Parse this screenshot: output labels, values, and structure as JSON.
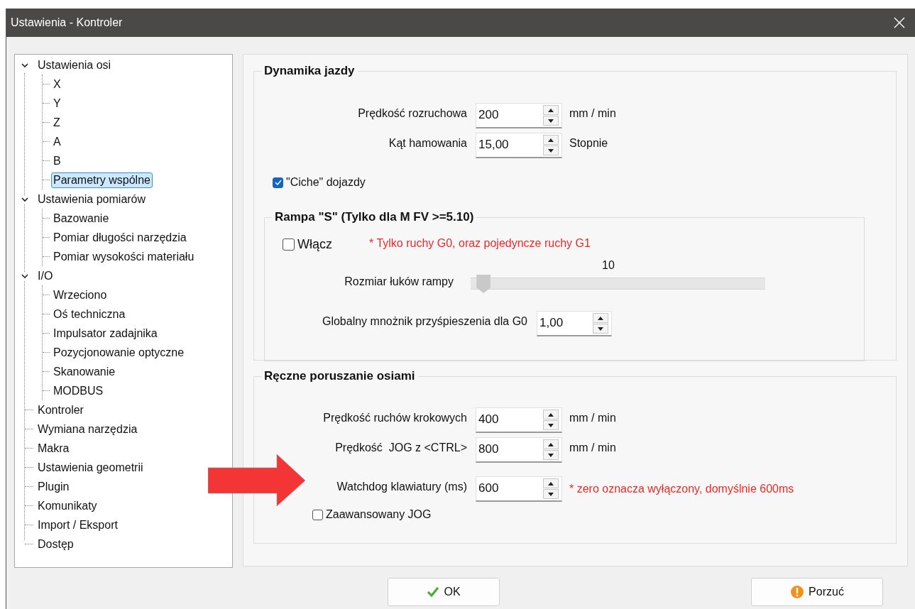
{
  "window": {
    "title": "Ustawienia - Kontroler"
  },
  "tree": [
    {
      "label": "Ustawienia osi",
      "expanded": true,
      "selected": false,
      "children": [
        {
          "label": "X",
          "selected": false
        },
        {
          "label": "Y",
          "selected": false
        },
        {
          "label": "Z",
          "selected": false
        },
        {
          "label": "A",
          "selected": false
        },
        {
          "label": "B",
          "selected": false
        },
        {
          "label": "Parametry wspólne",
          "selected": true
        }
      ]
    },
    {
      "label": "Ustawienia pomiarów",
      "expanded": true,
      "selected": false,
      "children": [
        {
          "label": "Bazowanie",
          "selected": false
        },
        {
          "label": "Pomiar długości narzędzia",
          "selected": false
        },
        {
          "label": "Pomiar wysokości materiału",
          "selected": false
        }
      ]
    },
    {
      "label": "I/O",
      "expanded": true,
      "selected": false,
      "children": [
        {
          "label": "Wrzeciono",
          "selected": false
        },
        {
          "label": "Oś techniczna",
          "selected": false
        },
        {
          "label": "Impulsator zadajnika",
          "selected": false
        },
        {
          "label": "Pozycjonowanie optyczne",
          "selected": false
        },
        {
          "label": "Skanowanie",
          "selected": false
        },
        {
          "label": "MODBUS",
          "selected": false
        }
      ]
    },
    {
      "label": "Kontroler",
      "selected": false
    },
    {
      "label": "Wymiana narzędzia",
      "selected": false
    },
    {
      "label": "Makra",
      "selected": false
    },
    {
      "label": "Ustawienia geometrii",
      "selected": false
    },
    {
      "label": "Plugin",
      "selected": false
    },
    {
      "label": "Komunikaty",
      "selected": false
    },
    {
      "label": "Import / Eksport",
      "selected": false
    },
    {
      "label": "Dostęp",
      "selected": false
    }
  ],
  "dynamics": {
    "title": "Dynamika jazdy",
    "fields": [
      {
        "label": "Prędkość rozruchowa",
        "value": "200",
        "unit": "mm / min"
      },
      {
        "label": "Kąt hamowania",
        "value": "15,00",
        "unit": "Stopnie"
      }
    ],
    "quiet_moves": {
      "label": "\"Ciche\" dojazdy",
      "checked": true
    }
  },
  "ramp": {
    "title": "Rampa \"S\" (Tylko dla M FV >=5.10)",
    "enable": {
      "label": "Włącz",
      "checked": false
    },
    "note": "* Tylko ruchy G0, oraz pojedyncze ruchy G1",
    "slider": {
      "label": "Rozmiar łuków rampy",
      "reading": "10",
      "level": 0.02
    },
    "multiplier": {
      "label": "Globalny mnożnik przyśpieszenia dla G0",
      "value": "1,00"
    }
  },
  "manual": {
    "title": "Ręczne poruszanie osiami",
    "fields": [
      {
        "label": "Prędkość ruchów krokowych",
        "value": "400",
        "unit": "mm / min"
      },
      {
        "label": "Prędkość  JOG z <CTRL>",
        "value": "800",
        "unit": "mm / min"
      },
      {
        "label": "Watchdog klawiatury (ms)",
        "value": "600",
        "note": "* zero oznacza wyłączony, domyślnie 600ms"
      }
    ],
    "advanced_jog": {
      "label": "Zaawansowany JOG",
      "checked": false
    }
  },
  "buttons": [
    {
      "label": "OK",
      "kind": "ok"
    },
    {
      "label": "Porzuć",
      "kind": "cancel"
    }
  ]
}
